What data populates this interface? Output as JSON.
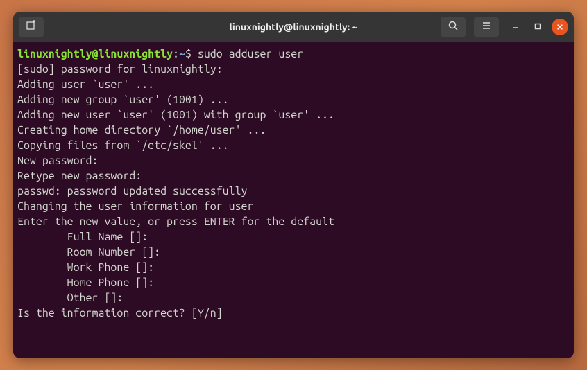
{
  "titlebar": {
    "title": "linuxnightly@linuxnightly: ~"
  },
  "prompt": {
    "user_host": "linuxnightly@linuxnightly",
    "colon": ":",
    "path": "~",
    "dollar": "$ ",
    "command": "sudo adduser user"
  },
  "output": [
    "[sudo] password for linuxnightly:",
    "Adding user `user' ...",
    "Adding new group `user' (1001) ...",
    "Adding new user `user' (1001) with group `user' ...",
    "Creating home directory `/home/user' ...",
    "Copying files from `/etc/skel' ...",
    "New password:",
    "Retype new password:",
    "passwd: password updated successfully",
    "Changing the user information for user",
    "Enter the new value, or press ENTER for the default",
    "        Full Name []:",
    "        Room Number []:",
    "        Work Phone []:",
    "        Home Phone []:",
    "        Other []:",
    "Is the information correct? [Y/n] "
  ]
}
